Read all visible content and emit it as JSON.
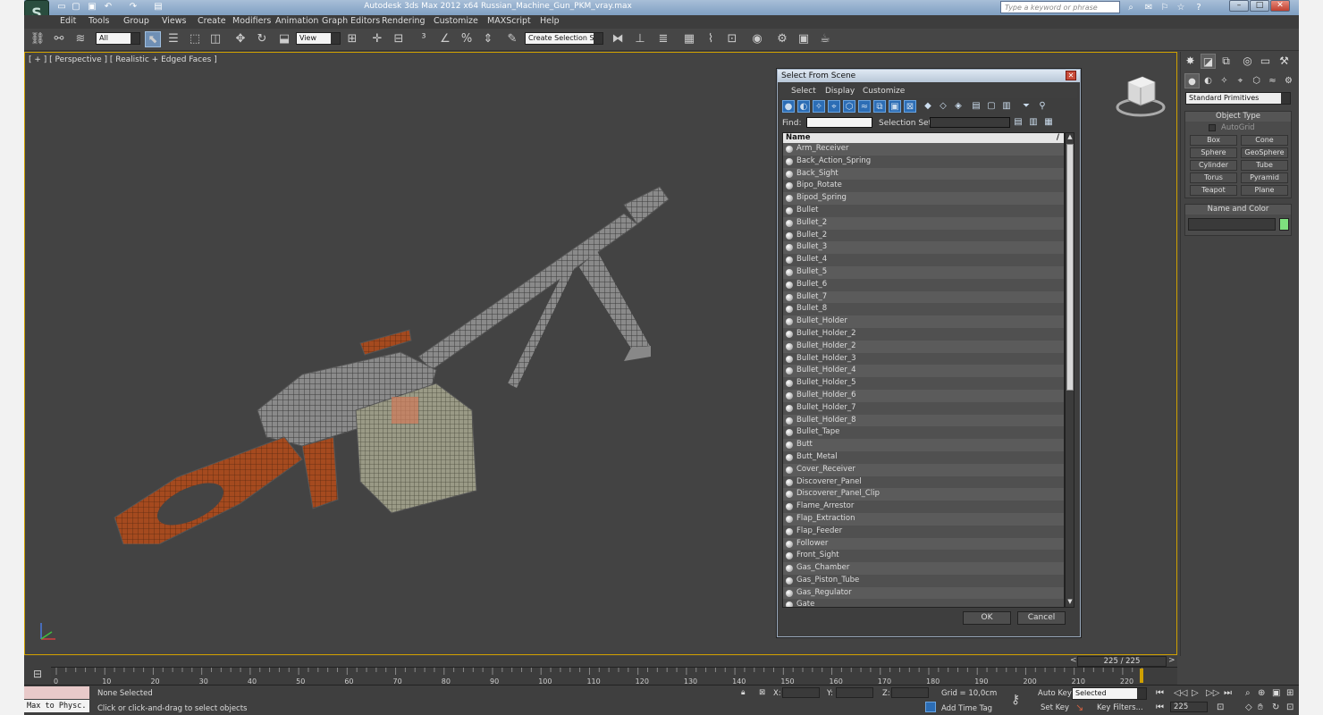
{
  "window": {
    "title": "Autodesk 3ds Max  2012 x64       Russian_Machine_Gun_PKM_vray.max",
    "search_placeholder": "Type a keyword or phrase"
  },
  "menu": [
    "Edit",
    "Tools",
    "Group",
    "Views",
    "Create",
    "Modifiers",
    "Animation",
    "Graph Editors",
    "Rendering",
    "Customize",
    "MAXScript",
    "Help"
  ],
  "toolbar": {
    "selection_filter": "All",
    "ref_coord": "View",
    "named_selection": "Create Selection Se"
  },
  "viewport": {
    "label": "[ + ] [ Perspective ] [ Realistic + Edged Faces ]",
    "accent_color": "#cfa000"
  },
  "dialog": {
    "title": "Select From Scene",
    "menu": [
      "Select",
      "Display",
      "Customize"
    ],
    "find_label": "Find:",
    "selset_label": "Selection Set:",
    "column_name": "Name",
    "items": [
      "Arm_Receiver",
      "Back_Action_Spring",
      "Back_Sight",
      "Bipo_Rotate",
      "Bipod_Spring",
      "Bullet",
      "Bullet_2",
      "Bullet_2",
      "Bullet_3",
      "Bullet_4",
      "Bullet_5",
      "Bullet_6",
      "Bullet_7",
      "Bullet_8",
      "Bullet_Holder",
      "Bullet_Holder_2",
      "Bullet_Holder_2",
      "Bullet_Holder_3",
      "Bullet_Holder_4",
      "Bullet_Holder_5",
      "Bullet_Holder_6",
      "Bullet_Holder_7",
      "Bullet_Holder_8",
      "Bullet_Tape",
      "Butt",
      "Butt_Metal",
      "Cover_Receiver",
      "Discoverer_Panel",
      "Discoverer_Panel_Clip",
      "Flame_Arrestor",
      "Flap_Extraction",
      "Flap_Feeder",
      "Follower",
      "Front_Sight",
      "Gas_Chamber",
      "Gas_Piston_Tube",
      "Gas_Regulator",
      "Gate"
    ],
    "ok": "OK",
    "cancel": "Cancel"
  },
  "command_panel": {
    "category": "Standard Primitives",
    "object_type_title": "Object Type",
    "autogrid": "AutoGrid",
    "buttons": [
      "Box",
      "Cone",
      "Sphere",
      "GeoSphere",
      "Cylinder",
      "Tube",
      "Torus",
      "Pyramid",
      "Teapot",
      "Plane"
    ],
    "name_color_title": "Name and Color",
    "swatch_color": "#7ee07e"
  },
  "timeline": {
    "frame": "225 / 225",
    "ticks": [
      "0",
      "10",
      "20",
      "30",
      "40",
      "50",
      "60",
      "70",
      "80",
      "90",
      "100",
      "110",
      "120",
      "130",
      "140",
      "150",
      "160",
      "170",
      "180",
      "190",
      "200",
      "210",
      "220"
    ]
  },
  "status": {
    "script_listener": "Max to Physc.",
    "selection": "None Selected",
    "prompt": "Click or click-and-drag to select objects",
    "x_label": "X:",
    "y_label": "Y:",
    "z_label": "Z:",
    "grid": "Grid = 10,0cm",
    "add_time_tag": "Add Time Tag",
    "auto_key": "Auto Key",
    "set_key": "Set Key",
    "key_mode": "Selected",
    "key_filters": "Key Filters...",
    "current_frame": "225"
  }
}
